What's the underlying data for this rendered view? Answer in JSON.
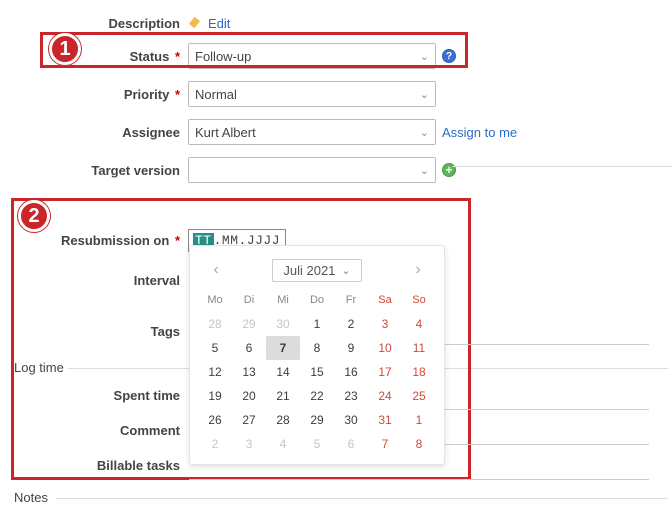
{
  "badges": {
    "one": "1",
    "two": "2"
  },
  "labels": {
    "description": "Description",
    "status": "Status",
    "priority": "Priority",
    "assignee": "Assignee",
    "target_version": "Target version",
    "resubmission": "Resubmission on",
    "interval": "Interval",
    "tags": "Tags",
    "log_time": "Log time",
    "spent_time": "Spent time",
    "comment": "Comment",
    "billable_tasks": "Billable tasks",
    "notes": "Notes"
  },
  "values": {
    "status": "Follow-up",
    "priority": "Normal",
    "assignee": "Kurt Albert",
    "target_version": "",
    "date_sel": "TT",
    "date_rest": ".MM.JJJJ"
  },
  "actions": {
    "edit": "Edit",
    "assign_to_me": "Assign to me"
  },
  "calendar": {
    "month_label": "Juli 2021",
    "dow": [
      "Mo",
      "Di",
      "Mi",
      "Do",
      "Fr",
      "Sa",
      "So"
    ],
    "days": [
      {
        "n": 28,
        "out": true
      },
      {
        "n": 29,
        "out": true
      },
      {
        "n": 30,
        "out": true
      },
      {
        "n": 1
      },
      {
        "n": 2
      },
      {
        "n": 3,
        "we": true
      },
      {
        "n": 4,
        "we": true
      },
      {
        "n": 5
      },
      {
        "n": 6
      },
      {
        "n": 7,
        "today": true
      },
      {
        "n": 8
      },
      {
        "n": 9
      },
      {
        "n": 10,
        "we": true
      },
      {
        "n": 11,
        "we": true
      },
      {
        "n": 12
      },
      {
        "n": 13
      },
      {
        "n": 14
      },
      {
        "n": 15
      },
      {
        "n": 16
      },
      {
        "n": 17,
        "we": true
      },
      {
        "n": 18,
        "we": true
      },
      {
        "n": 19
      },
      {
        "n": 20
      },
      {
        "n": 21
      },
      {
        "n": 22
      },
      {
        "n": 23
      },
      {
        "n": 24,
        "we": true
      },
      {
        "n": 25,
        "we": true
      },
      {
        "n": 26
      },
      {
        "n": 27
      },
      {
        "n": 28
      },
      {
        "n": 29
      },
      {
        "n": 30
      },
      {
        "n": 31,
        "we": true
      },
      {
        "n": 1,
        "out": true,
        "we": true
      },
      {
        "n": 2,
        "out": true
      },
      {
        "n": 3,
        "out": true
      },
      {
        "n": 4,
        "out": true
      },
      {
        "n": 5,
        "out": true
      },
      {
        "n": 6,
        "out": true
      },
      {
        "n": 7,
        "out": true,
        "we": true
      },
      {
        "n": 8,
        "out": true,
        "we": true
      }
    ]
  }
}
